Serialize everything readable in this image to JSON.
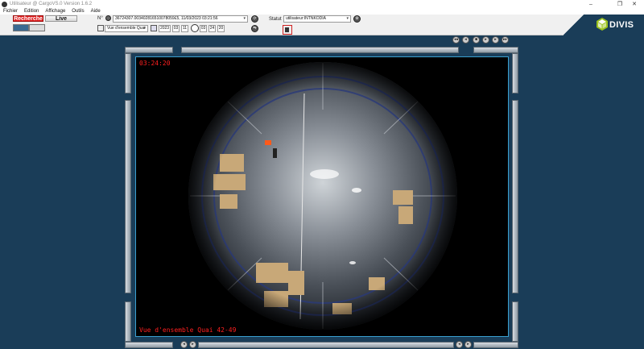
{
  "window": {
    "title": "Utilisateur @ CargoVS.0 Version 1.6.2"
  },
  "menu": {
    "items": [
      "Fichier",
      "Edition",
      "Affichage",
      "Outils",
      "Aide"
    ]
  },
  "mode_tabs": {
    "recherche": "Recherche",
    "live": "Live"
  },
  "toolbar": {
    "n_label": "N°",
    "record_value": "36724307.003402816510078059£5, 11/03/2023 03:21:56",
    "statut_label": "Statut",
    "statut_value": "utilisateur:INTNKODIA",
    "view_value": "Vue d'ensemble Quai",
    "date": {
      "year": "2023",
      "month": "03",
      "day": "11"
    },
    "time": {
      "hour": "03",
      "minute": "24",
      "second": "20"
    }
  },
  "logo": {
    "text": "DIVIS"
  },
  "video": {
    "timestamp_overlay": "03:24:20",
    "camera_overlay": "Vue d'ensemble Quai 42-49"
  },
  "colors": {
    "background": "#1a3d58",
    "overlay_text": "#ff2020",
    "recherche_button": "#e02020",
    "video_border": "#3aa0d0"
  },
  "icons": {
    "nav_controls": [
      "rewind-icon",
      "step-back-icon",
      "stop-icon",
      "play-icon",
      "step-forward-icon",
      "fast-forward-icon"
    ]
  }
}
